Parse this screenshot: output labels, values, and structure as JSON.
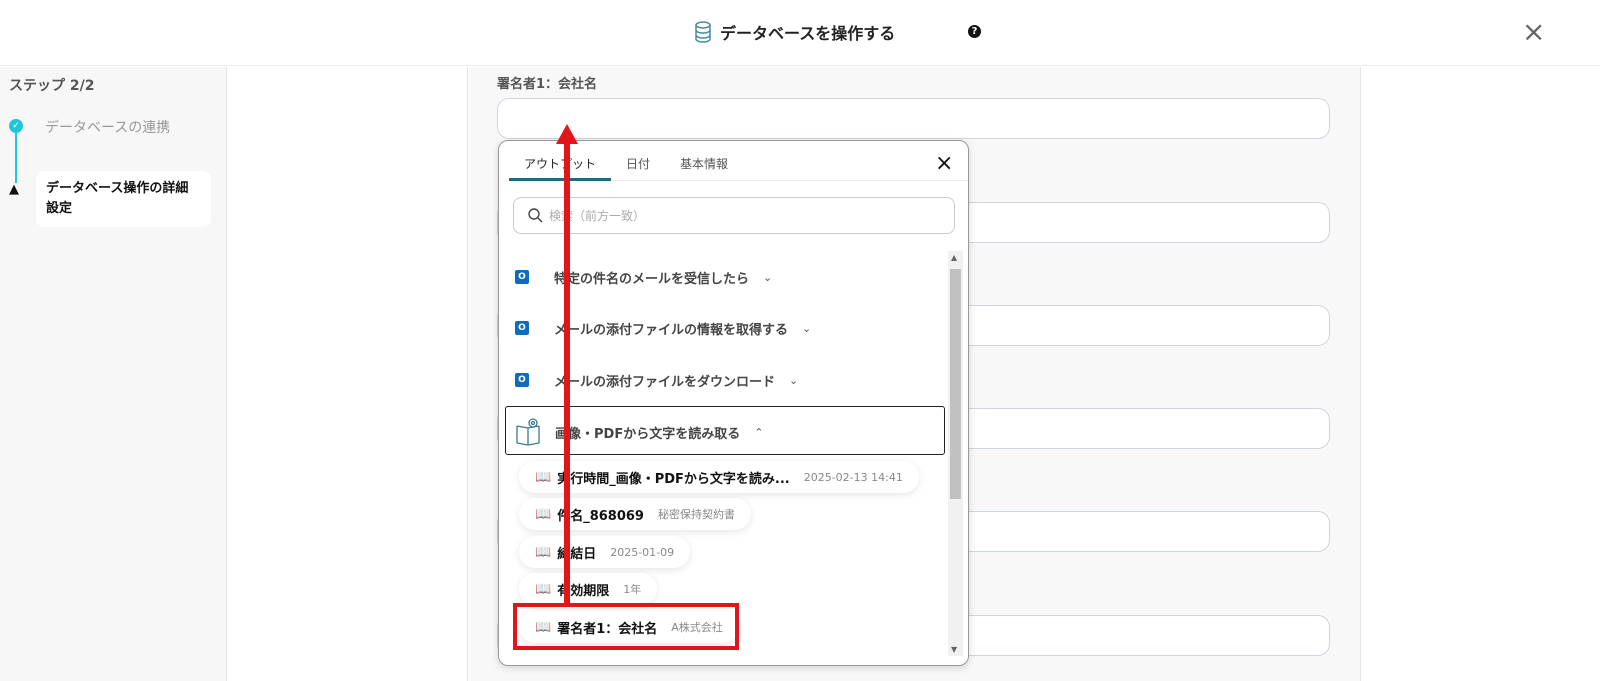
{
  "header": {
    "title": "データベースを操作する",
    "help": "?",
    "close": "×"
  },
  "sidebar": {
    "step_label": "ステップ 2/2",
    "steps": [
      {
        "label": "データベースの連携",
        "status": "done"
      },
      {
        "label": "データベース操作の詳細設定",
        "status": "warning"
      }
    ]
  },
  "main": {
    "field_label": "署名者1：会社名"
  },
  "popup": {
    "tabs": [
      "アウトプット",
      "日付",
      "基本情報"
    ],
    "close": "×",
    "search_placeholder": "検索（前方一致）",
    "groups": [
      {
        "label": "特定の件名のメールを受信したら",
        "icon": "outlook-icon",
        "chevron": "⌄"
      },
      {
        "label": "メールの添付ファイルの情報を取得する",
        "icon": "outlook-icon",
        "chevron": "⌄"
      },
      {
        "label": "メールの添付ファイルをダウンロード",
        "icon": "outlook-icon",
        "chevron": "⌄"
      },
      {
        "label": "画像・PDFから文字を読み取る",
        "icon": "ocr-book-icon",
        "chevron": "⌃"
      }
    ],
    "items": [
      {
        "name": "実行時間_画像・PDFから文字を読み...",
        "value": "2025-02-13 14:41"
      },
      {
        "name": "件名_868069",
        "value": "秘密保持契約書"
      },
      {
        "name": "締結日",
        "value": "2025-01-09"
      },
      {
        "name": "有効期限",
        "value": "1年"
      },
      {
        "name": "署名者1：会社名",
        "value": "A株式会社"
      }
    ]
  },
  "colors": {
    "accent": "#1ec8d8",
    "tab_underline": "#1f6a80",
    "annotation": "#e0161b"
  }
}
